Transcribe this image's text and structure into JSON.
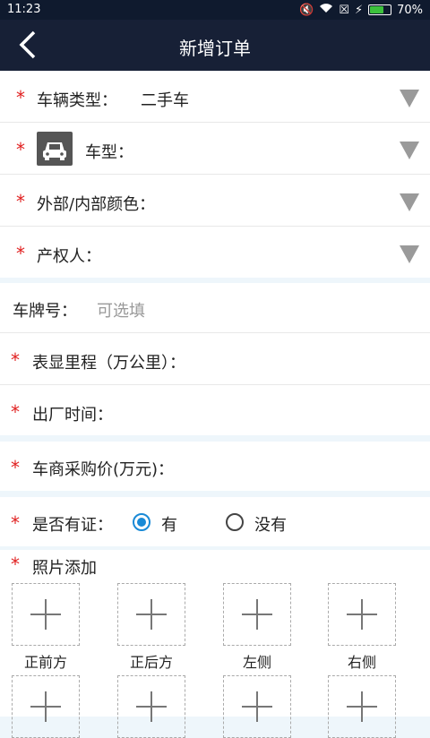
{
  "status_bar": {
    "time": "11:23",
    "battery_percent": "70%",
    "battery_level": 0.7
  },
  "header": {
    "title": "新增订单"
  },
  "form": {
    "vehicle_type": {
      "label": "车辆类型：",
      "value": "二手车"
    },
    "car_model": {
      "label": "车型："
    },
    "color": {
      "label": "外部/内部颜色："
    },
    "owner": {
      "label": "产权人："
    },
    "plate": {
      "label": "车牌号：",
      "placeholder": "可选填"
    },
    "mileage": {
      "label": "表显里程（万公里）："
    },
    "factory_date": {
      "label": "出厂时间："
    },
    "purchase_price": {
      "label": "车商采购价(万元)："
    },
    "certificate": {
      "label": "是否有证：",
      "option_yes": "有",
      "option_no": "没有",
      "selected": "有"
    }
  },
  "photos": {
    "title": "照片添加",
    "slots": [
      "正前方",
      "正后方",
      "左侧",
      "右侧"
    ]
  },
  "required_mark": "*",
  "colors": {
    "navbar": "#172036",
    "required": "#e02020",
    "accent": "#1a8ad6"
  }
}
